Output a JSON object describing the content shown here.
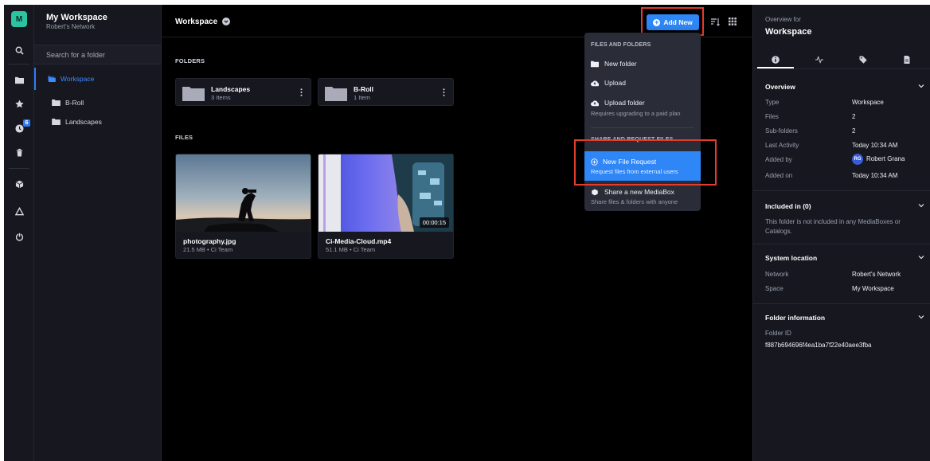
{
  "rail": {
    "workspace_initial": "M",
    "recent_badge": "6",
    "icons": [
      "folder-icon",
      "star-icon",
      "clock-icon",
      "trash-icon",
      "box-icon",
      "triangle-icon",
      "power-icon"
    ]
  },
  "sidebar": {
    "title": "My Workspace",
    "subtitle": "Robert's Network",
    "search_placeholder": "Search for a folder",
    "items": [
      {
        "label": "Workspace",
        "active": true
      },
      {
        "label": "B-Roll",
        "active": false
      },
      {
        "label": "Landscapes",
        "active": false
      }
    ]
  },
  "header": {
    "title": "Workspace",
    "add_new_label": "Add New"
  },
  "main": {
    "folders_label": "FOLDERS",
    "files_label": "FILES",
    "folders": [
      {
        "name": "Landscapes",
        "count": "3 Items"
      },
      {
        "name": "B-Roll",
        "count": "1 Item"
      }
    ],
    "files": [
      {
        "name": "photography.jpg",
        "meta": "21.5 MB • Ci Team"
      },
      {
        "name": "Ci-Media-Cloud.mp4",
        "meta": "51.1 MB • Ci Team",
        "duration": "00:00:15"
      }
    ]
  },
  "dropdown": {
    "section1": "FILES AND FOLDERS",
    "new_folder": "New folder",
    "upload": "Upload",
    "upload_folder": "Upload folder",
    "upload_folder_sub": "Requires upgrading to a paid plan",
    "section2": "SHARE AND REQUEST FILES",
    "new_file_request": "New File Request",
    "new_file_request_sub": "Request files from external users",
    "share_mediabox": "Share a new MediaBox",
    "share_mediabox_sub": "Share files & folders with anyone"
  },
  "right_panel": {
    "overview_for": "Overview for",
    "title": "Workspace",
    "overview": {
      "heading": "Overview",
      "rows": [
        {
          "k": "Type",
          "v": "Workspace"
        },
        {
          "k": "Files",
          "v": "2"
        },
        {
          "k": "Sub-folders",
          "v": "2"
        },
        {
          "k": "Last Activity",
          "v": "Today 10:34 AM"
        },
        {
          "k": "Added by",
          "v": "Robert Grana"
        },
        {
          "k": "Added on",
          "v": "Today 10:34 AM"
        }
      ],
      "added_by_initials": "RG"
    },
    "included": {
      "heading": "Included in (0)",
      "text": "This folder is not included in any MediaBoxes or Catalogs."
    },
    "system": {
      "heading": "System location",
      "rows": [
        {
          "k": "Network",
          "v": "Robert's Network"
        },
        {
          "k": "Space",
          "v": "My Workspace"
        }
      ]
    },
    "folder_info": {
      "heading": "Folder information",
      "id_label": "Folder ID",
      "id_value": "f887b694696f4ea1ba7f22e40aee3fba"
    }
  },
  "colors": {
    "accent": "#2f86f6",
    "highlight_box": "#e23c2b",
    "avatar": "#2cc4a0"
  }
}
